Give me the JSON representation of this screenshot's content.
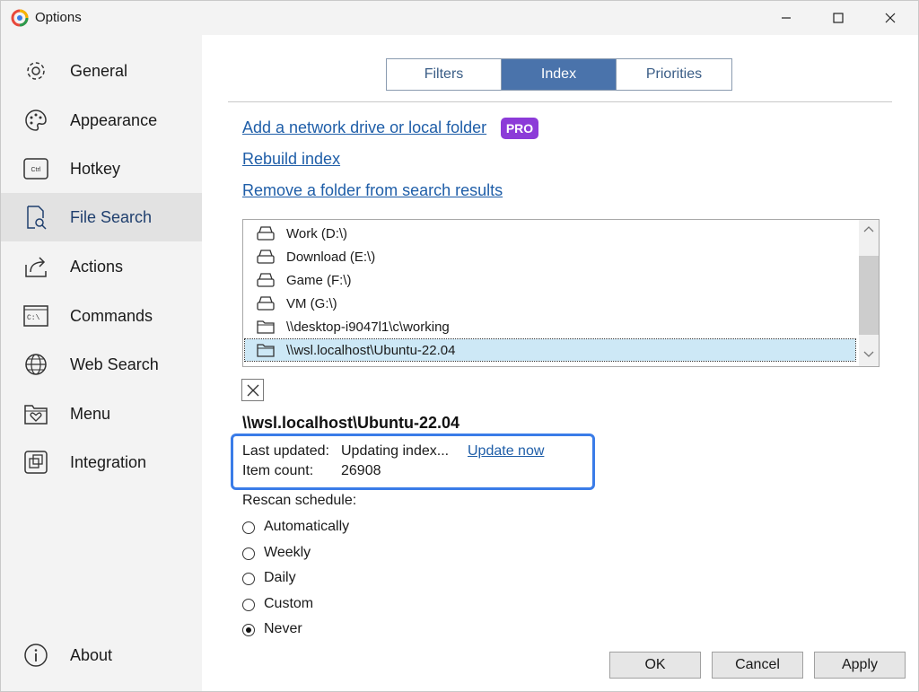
{
  "window": {
    "title": "Options",
    "icons": [
      "app-icon",
      "minimize-icon",
      "maximize-icon",
      "close-icon"
    ]
  },
  "sidebar": {
    "items": [
      {
        "label": "General",
        "icon": "gear-icon",
        "active": false
      },
      {
        "label": "Appearance",
        "icon": "palette-icon",
        "active": false
      },
      {
        "label": "Hotkey",
        "icon": "keyboard-ctrl-icon",
        "active": false
      },
      {
        "label": "File Search",
        "icon": "file-search-icon",
        "active": true
      },
      {
        "label": "Actions",
        "icon": "share-icon",
        "active": false
      },
      {
        "label": "Commands",
        "icon": "terminal-icon",
        "active": false
      },
      {
        "label": "Web Search",
        "icon": "globe-icon",
        "active": false
      },
      {
        "label": "Menu",
        "icon": "heart-folder-icon",
        "active": false
      },
      {
        "label": "Integration",
        "icon": "integration-icon",
        "active": false
      }
    ],
    "about": {
      "label": "About",
      "icon": "info-icon"
    }
  },
  "tabs": [
    {
      "label": "Filters",
      "active": false
    },
    {
      "label": "Index",
      "active": true
    },
    {
      "label": "Priorities",
      "active": false
    }
  ],
  "links": {
    "add_folder": "Add a network drive or local folder",
    "pro_badge": "PRO",
    "rebuild": "Rebuild index",
    "remove_folder": "Remove a folder from search results"
  },
  "folders": [
    {
      "label": "Work (D:\\)",
      "icon": "drive-icon",
      "selected": false
    },
    {
      "label": "Download (E:\\)",
      "icon": "drive-icon",
      "selected": false
    },
    {
      "label": "Game (F:\\)",
      "icon": "drive-icon",
      "selected": false
    },
    {
      "label": "VM (G:\\)",
      "icon": "drive-icon",
      "selected": false
    },
    {
      "label": "\\\\desktop-i9047l1\\c\\working",
      "icon": "folder-icon",
      "selected": false
    },
    {
      "label": "\\\\wsl.localhost\\Ubuntu-22.04",
      "icon": "folder-icon",
      "selected": true
    }
  ],
  "details": {
    "folder_name": "\\\\wsl.localhost\\Ubuntu-22.04",
    "last_updated_label": "Last updated:",
    "last_updated_value": "Updating index...",
    "update_now": "Update now",
    "item_count_label": "Item count:",
    "item_count_value": "26908"
  },
  "rescan": {
    "label": "Rescan schedule:",
    "options": [
      "Automatically",
      "Weekly",
      "Daily",
      "Custom",
      "Never"
    ],
    "selected": "Never"
  },
  "buttons": {
    "ok": "OK",
    "cancel": "Cancel",
    "apply": "Apply"
  },
  "colors": {
    "accent": "#4a73ab",
    "link": "#1f5ea8",
    "pro": "#8c3bd8",
    "highlight_border": "#3a7ce8",
    "selected_row": "#cde8f6"
  }
}
